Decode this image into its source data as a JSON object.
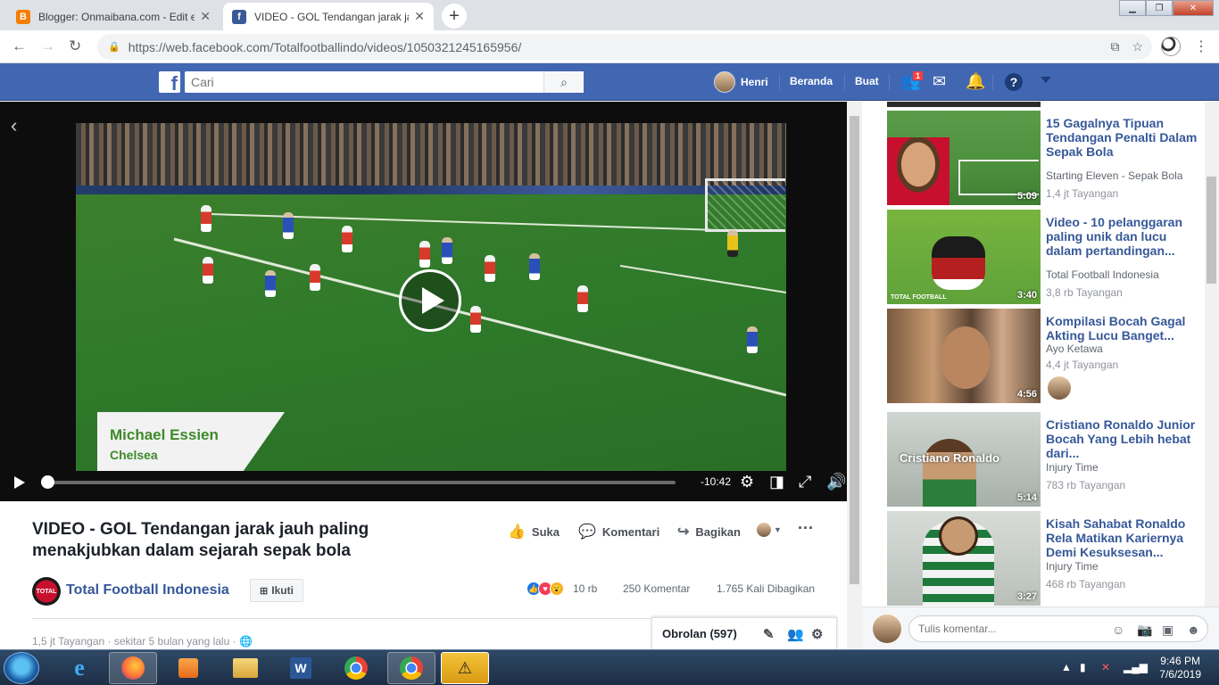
{
  "browser": {
    "tabs": [
      {
        "title": "Blogger: Onmaibana.com - Edit e",
        "favicon": "B",
        "active": false
      },
      {
        "title": "VIDEO - GOL Tendangan jarak ja",
        "favicon": "f",
        "active": true
      }
    ],
    "url": "https://web.facebook.com/Totalfootballindo/videos/1050321245165956/",
    "brand_color": "#4267b2"
  },
  "fb_header": {
    "search_placeholder": "Cari",
    "user_name": "Henri",
    "home_label": "Beranda",
    "create_label": "Buat",
    "friend_requests_badge": "1"
  },
  "video": {
    "remaining_time": "-10:42",
    "progress": 0.0,
    "caption_name": "Michael Essien",
    "caption_club": "Chelsea",
    "title": "VIDEO - GOL Tendangan jarak jauh paling menakjubkan dalam sejarah sepak bola",
    "actions": {
      "like": "Suka",
      "comment": "Komentari",
      "share": "Bagikan"
    },
    "page_name": "Total Football Indonesia",
    "page_avatar_text": "TOTAL",
    "follow_label": "Ikuti",
    "reactions_count": "10 rb",
    "comments_count": "250 Komentar",
    "shares_count": "1.765 Kali Dibagikan",
    "views_line": "1,5 jt Tayangan · sekitar 5 bulan yang lalu ·"
  },
  "chat": {
    "label": "Obrolan (597)"
  },
  "sidebar": {
    "items": [
      {
        "title": "15 Gagalnya Tipuan Tendangan Penalti Dalam Sepak Bola",
        "channel": "Starting Eleven - Sepak Bola",
        "views": "1,4 jt Tayangan",
        "duration": "5:09"
      },
      {
        "title": "Video - 10 pelanggaran paling unik dan lucu dalam pertandingan...",
        "channel": "Total Football Indonesia",
        "views": "3,8 rb Tayangan",
        "duration": "3:40",
        "thumb_text": "TOTAL FOOTBALL"
      },
      {
        "title": "Kompilasi Bocah Gagal Akting Lucu Banget...",
        "channel": "Ayo Ketawa",
        "views": "4,4 jt Tayangan",
        "duration": "4:56"
      },
      {
        "title": "Cristiano Ronaldo Junior Bocah Yang Lebih hebat dari...",
        "channel": "Injury Time",
        "views": "783 rb Tayangan",
        "duration": "5:14",
        "thumb_text": "Cristiano Ronaldo"
      },
      {
        "title": "Kisah Sahabat Ronaldo Rela Matikan Kariernya Demi Kesuksesan...",
        "channel": "Injury Time",
        "views": "468 rb Tayangan",
        "duration": "3:27"
      }
    ],
    "comment_placeholder": "Tulis komentar..."
  },
  "taskbar": {
    "time": "9:46 PM",
    "date": "7/6/2019"
  }
}
